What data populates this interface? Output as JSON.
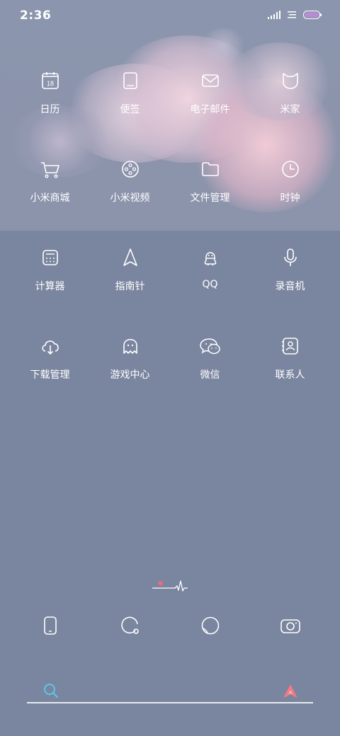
{
  "status": {
    "time": "2:36"
  },
  "apps": [
    {
      "label": "日历",
      "icon": "calendar-icon",
      "badge": "18"
    },
    {
      "label": "便签",
      "icon": "notes-icon"
    },
    {
      "label": "电子邮件",
      "icon": "mail-icon"
    },
    {
      "label": "米家",
      "icon": "mijia-icon"
    },
    {
      "label": "小米商城",
      "icon": "cart-icon"
    },
    {
      "label": "小米视频",
      "icon": "film-reel-icon"
    },
    {
      "label": "文件管理",
      "icon": "folder-icon"
    },
    {
      "label": "时钟",
      "icon": "clock-icon"
    },
    {
      "label": "计算器",
      "icon": "calculator-icon"
    },
    {
      "label": "指南针",
      "icon": "compass-arrow-icon"
    },
    {
      "label": "QQ",
      "icon": "qq-penguin-icon"
    },
    {
      "label": "录音机",
      "icon": "microphone-icon"
    },
    {
      "label": "下载管理",
      "icon": "cloud-download-icon"
    },
    {
      "label": "游戏中心",
      "icon": "ghost-icon"
    },
    {
      "label": "微信",
      "icon": "wechat-icon"
    },
    {
      "label": "联系人",
      "icon": "contacts-book-icon"
    }
  ],
  "dock": [
    {
      "icon": "phone-icon"
    },
    {
      "icon": "message-bubble-icon"
    },
    {
      "icon": "browser-circle-icon"
    },
    {
      "icon": "camera-icon"
    }
  ],
  "colors": {
    "background": "#7a859f",
    "heart": "#f06a7e",
    "search_icon": "#5ac8e8",
    "assistant_icon": "#f07a86"
  }
}
